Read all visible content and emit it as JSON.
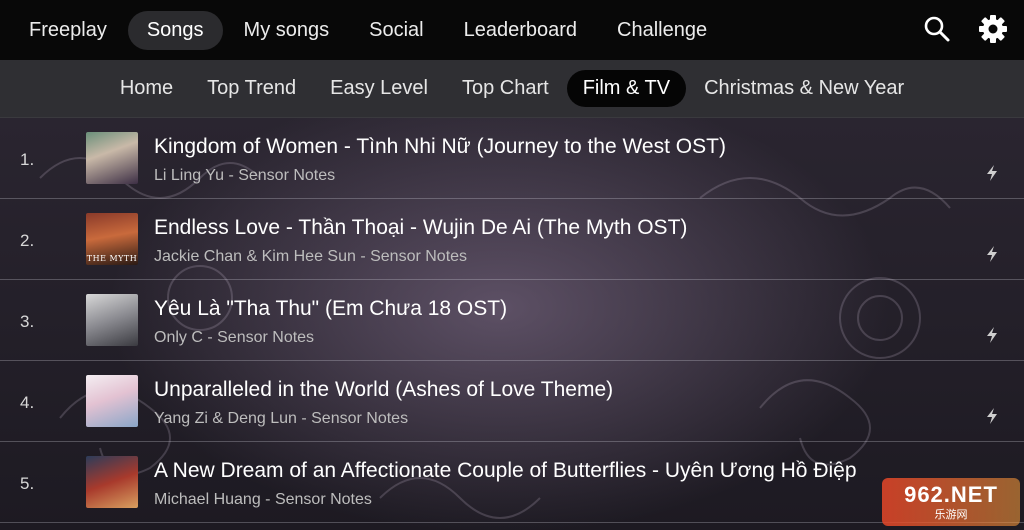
{
  "main_tabs": [
    {
      "label": "Freeplay",
      "active": false
    },
    {
      "label": "Songs",
      "active": true
    },
    {
      "label": "My songs",
      "active": false
    },
    {
      "label": "Social",
      "active": false
    },
    {
      "label": "Leaderboard",
      "active": false
    },
    {
      "label": "Challenge",
      "active": false
    }
  ],
  "top_icons": [
    "search-icon",
    "gear-icon"
  ],
  "sub_tabs": [
    {
      "label": "Home",
      "active": false
    },
    {
      "label": "Top Trend",
      "active": false
    },
    {
      "label": "Easy Level",
      "active": false
    },
    {
      "label": "Top Chart",
      "active": false
    },
    {
      "label": "Film & TV",
      "active": true
    },
    {
      "label": "Christmas & New Year",
      "active": false
    }
  ],
  "songs": [
    {
      "rank": "1.",
      "title": "Kingdom of Women - Tình Nhi Nữ (Journey to the West OST)",
      "subtitle": "Li Ling Yu - Sensor Notes",
      "thumb_caption": "",
      "icon": "bolt-icon"
    },
    {
      "rank": "2.",
      "title": "Endless Love - Thần Thoại - Wujin De Ai (The Myth OST)",
      "subtitle": "Jackie Chan & Kim Hee Sun - Sensor Notes",
      "thumb_caption": "THE MYTH",
      "icon": "bolt-icon"
    },
    {
      "rank": "3.",
      "title": "Yêu Là \"Tha Thu\" (Em Chưa 18 OST)",
      "subtitle": "Only C - Sensor Notes",
      "thumb_caption": "",
      "icon": "bolt-icon"
    },
    {
      "rank": "4.",
      "title": "Unparalleled in the World (Ashes of Love Theme)",
      "subtitle": "Yang Zi & Deng Lun - Sensor Notes",
      "thumb_caption": "",
      "icon": "bolt-icon"
    },
    {
      "rank": "5.",
      "title": "A New Dream of an Affectionate Couple of Butterflies - Uyên Ương Hồ Điệp",
      "subtitle": "Michael Huang - Sensor Notes",
      "thumb_caption": "",
      "icon": ""
    }
  ],
  "watermark": {
    "main": "962.NET",
    "sub": "乐游网"
  },
  "colors": {
    "topbar": "#080808",
    "subbar": "#2f2f33",
    "active_main": "#2b2b2e",
    "active_sub": "#050505"
  }
}
